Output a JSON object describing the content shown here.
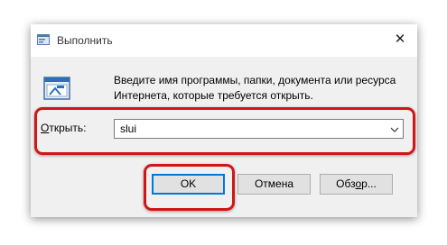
{
  "window": {
    "title": "Выполнить",
    "close_glyph": "✕"
  },
  "description": "Введите имя программы, папки, документа или ресурса Интернета, которые требуется открыть.",
  "open_field": {
    "label_underlined": "О",
    "label_rest": "ткрыть:",
    "value": "slui"
  },
  "buttons": {
    "ok": "OK",
    "cancel": "Отмена",
    "browse_before": "Обз",
    "browse_underlined": "о",
    "browse_after": "р..."
  },
  "icons": {
    "app": "run-app-icon",
    "run": "run-dialog-icon",
    "close": "close-icon",
    "dropdown": "chevron-down-icon"
  },
  "colors": {
    "highlight": "#d11616",
    "default_button_border": "#0078d7",
    "dialog_bg": "#f0f0f0"
  }
}
